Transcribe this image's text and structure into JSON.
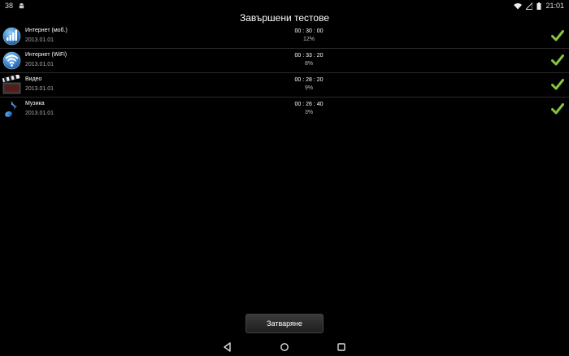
{
  "status_bar": {
    "left_text": "38",
    "time": "21:01"
  },
  "title": "Завършени тестове",
  "rows": [
    {
      "name": "Интернет (моб.)",
      "date": "2013.01.01",
      "time": "00 : 30 : 00",
      "percent": "12%",
      "icon": "mobile-signal-icon"
    },
    {
      "name": "Интернет (WiFi)",
      "date": "2013.01.01",
      "time": "00 : 33 : 20",
      "percent": "8%",
      "icon": "wifi-icon"
    },
    {
      "name": "Видео",
      "date": "2013.01.01",
      "time": "00 : 28 : 20",
      "percent": "9%",
      "icon": "clapperboard-icon"
    },
    {
      "name": "Музика",
      "date": "2013.01.01",
      "time": "00 : 26 : 40",
      "percent": "3%",
      "icon": "music-note-icon"
    }
  ],
  "close_button": "Затваряне",
  "colors": {
    "check": "#8ac43f",
    "icon_blue": "#2a7fd4"
  }
}
